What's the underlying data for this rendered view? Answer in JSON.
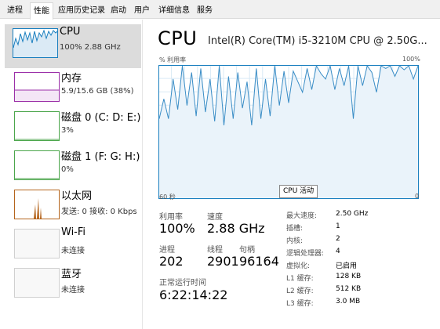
{
  "tabs": [
    {
      "label": "进程"
    },
    {
      "label": "性能"
    },
    {
      "label": "应用历史记录"
    },
    {
      "label": "启动"
    },
    {
      "label": "用户"
    },
    {
      "label": "详细信息"
    },
    {
      "label": "服务"
    }
  ],
  "sidebar": {
    "items": [
      {
        "title": "CPU",
        "subtitle": "100%  2.88 GHz",
        "color": "#1a7fbf"
      },
      {
        "title": "内存",
        "subtitle": "5.9/15.6 GB (38%)",
        "color": "#9b30a8"
      },
      {
        "title": "磁盘 0 (C: D: E:)",
        "subtitle": "3%",
        "color": "#4ca64c"
      },
      {
        "title": "磁盘 1 (F: G: H:)",
        "subtitle": "0%",
        "color": "#4ca64c"
      },
      {
        "title": "以太网",
        "subtitle": "发送: 0  接收: 0 Kbps",
        "color": "#b5651d"
      },
      {
        "title": "Wi-Fi",
        "subtitle": "未连接",
        "color": "#aaaaaa"
      },
      {
        "title": "蓝牙",
        "subtitle": "未连接",
        "color": "#aaaaaa"
      }
    ]
  },
  "main": {
    "title": "CPU",
    "processor": "Intel(R) Core(TM) i5-3210M CPU @ 2.50G...",
    "graph_label_top_left": "% 利用率",
    "graph_label_top_right": "100%",
    "graph_label_bottom_left": "60 秒",
    "graph_label_bottom_right": "0",
    "tooltip": "CPU 活动",
    "stats": {
      "utilization_label": "利用率",
      "utilization_value": "100%",
      "speed_label": "速度",
      "speed_value": "2.88 GHz",
      "processes_label": "进程",
      "processes_value": "202",
      "threads_label": "线程",
      "threads_value": "2901",
      "handles_label": "句柄",
      "handles_value": "96164",
      "uptime_label": "正常运行时间",
      "uptime_value": "6:22:14:22"
    },
    "details": [
      {
        "label": "最大速度:",
        "value": "2.50 GHz"
      },
      {
        "label": "插槽:",
        "value": "1"
      },
      {
        "label": "内核:",
        "value": "2"
      },
      {
        "label": "逻辑处理器:",
        "value": "4"
      },
      {
        "label": "虚拟化:",
        "value": "已启用"
      },
      {
        "label": "L1 缓存:",
        "value": "128 KB"
      },
      {
        "label": "L2 缓存:",
        "value": "512 KB"
      },
      {
        "label": "L3 缓存:",
        "value": "3.0 MB"
      }
    ],
    "cpu_history_percent": [
      60,
      75,
      60,
      90,
      67,
      100,
      70,
      95,
      62,
      98,
      65,
      90,
      58,
      100,
      55,
      92,
      60,
      95,
      68,
      88,
      55,
      98,
      60,
      90,
      62,
      100,
      70,
      96,
      72,
      96,
      88,
      80,
      98,
      82,
      100,
      94,
      90,
      100,
      82,
      98,
      85,
      100,
      60,
      100,
      85,
      100,
      95,
      80,
      100,
      98,
      100,
      92,
      100,
      97,
      100,
      90,
      100
    ]
  }
}
